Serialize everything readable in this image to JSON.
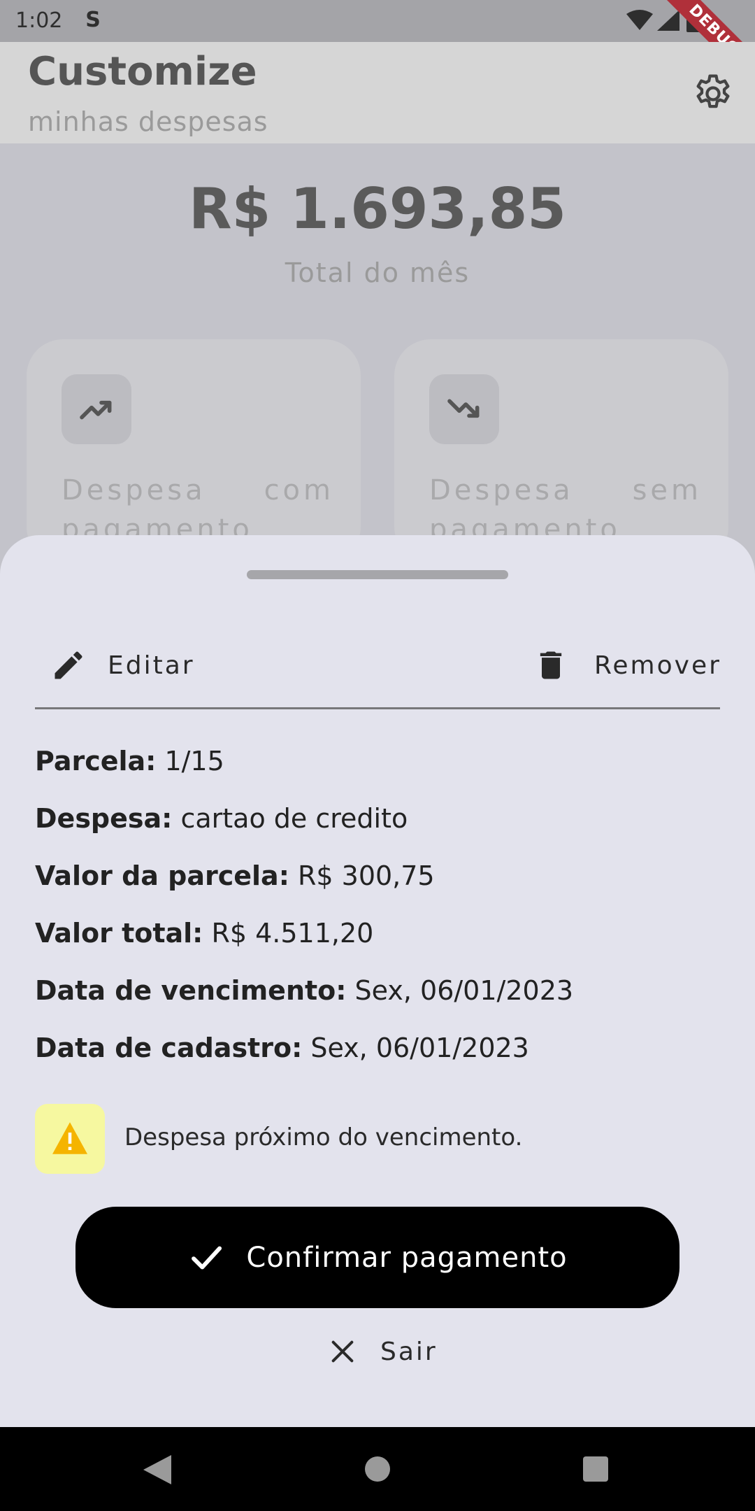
{
  "status_bar": {
    "time": "1:02",
    "debug_label": "DEBUG",
    "icons": [
      "s-icon",
      "wifi-icon",
      "signal-icon",
      "battery-icon"
    ]
  },
  "app_bar": {
    "title": "Customize",
    "subtitle": "minhas despesas",
    "settings_icon": "gear-icon"
  },
  "summary": {
    "total_amount": "R$ 1.693,85",
    "total_label": "Total do mês"
  },
  "cards": [
    {
      "icon": "trending-up-icon",
      "label": "Despesa com pagamento"
    },
    {
      "icon": "trending-down-icon",
      "label": "Despesa sem pagamento"
    }
  ],
  "sheet": {
    "edit_label": "Editar",
    "remove_label": "Remover",
    "details": [
      {
        "key": "Parcela:",
        "value": " 1/15"
      },
      {
        "key": "Despesa:",
        "value": " cartao de credito"
      },
      {
        "key": "Valor da parcela:",
        "value": " R$ 300,75"
      },
      {
        "key": "Valor total:",
        "value": " R$ 4.511,20"
      },
      {
        "key": "Data de vencimento:",
        "value": " Sex, 06/01/2023"
      },
      {
        "key": "Data de cadastro:",
        "value": " Sex, 06/01/2023"
      }
    ],
    "warning_text": "Despesa próximo do vencimento.",
    "confirm_label": "Confirmar pagamento",
    "exit_label": "Sair"
  },
  "colors": {
    "warning_bg": "#f6f8a0",
    "warning_icon": "#f5b400",
    "confirm_bg": "#000000",
    "debug_banner": "#b0303a"
  }
}
